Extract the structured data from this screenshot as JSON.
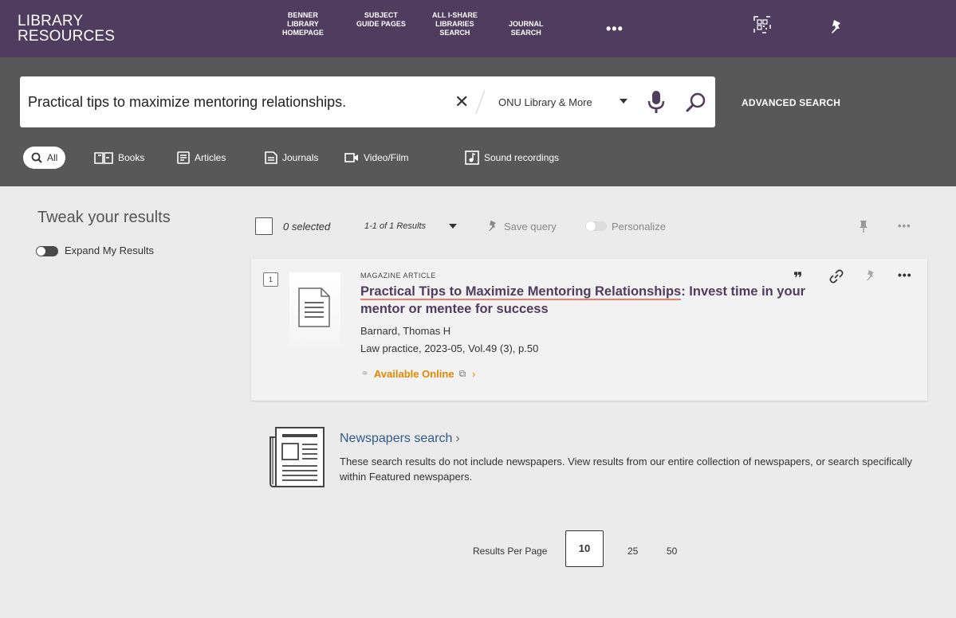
{
  "header": {
    "logo_line1": "LIBRARY",
    "logo_line2": "RESOURCES",
    "nav": [
      {
        "label": "BENNER\nLIBRARY\nHOMEPAGE"
      },
      {
        "label": "SUBJECT\nGUIDE PAGES"
      },
      {
        "label": "ALL I-SHARE\nLIBRARIES\nSEARCH"
      },
      {
        "label": "JOURNAL\nSEARCH"
      }
    ],
    "more_label": "•••",
    "icons": [
      "qr-code-icon",
      "pin-icon"
    ],
    "background": "#4f3c5e"
  },
  "search": {
    "query": "Practical tips to maximize mentoring relationships.",
    "clear_label": "✕",
    "scope": "ONU Library & More",
    "advanced_label": "ADVANCED SEARCH"
  },
  "tabs": [
    {
      "label": "All",
      "icon": "search-icon",
      "active": true
    },
    {
      "label": "Books",
      "icon": "book-icon"
    },
    {
      "label": "Articles",
      "icon": "article-icon"
    },
    {
      "label": "Journals",
      "icon": "journal-icon"
    },
    {
      "label": "Video/Film",
      "icon": "video-icon"
    },
    {
      "label": "Sound recordings",
      "icon": "sound-icon"
    }
  ],
  "facets": {
    "title": "Tweak your results",
    "expand_label": "Expand My Results"
  },
  "toolbar": {
    "selected": "0 selected",
    "range": "1-1 of 1 Results",
    "save_query": "Save query",
    "personalize": "Personalize",
    "more": "•••"
  },
  "result": {
    "number": "1",
    "type": "MAGAZINE ARTICLE",
    "title_main": "Practical Tips to Maximize Mentoring Relationships",
    "title_sub": ": Invest time in your mentor or mentee for success",
    "author": "Barnard, Thomas H",
    "source": "Law practice, 2023-05, Vol.49 (3), p.50",
    "availability": "Available Online",
    "cite": "❞",
    "more": "•••"
  },
  "newspapers": {
    "title": "Newspapers search",
    "chevron": "›",
    "description": "These search results do not include newspapers. View results from our entire collection of newspapers, or search specifically within Featured newspapers."
  },
  "pagination": {
    "label": "Results Per Page",
    "options": [
      "10",
      "25",
      "50"
    ],
    "selected": "10"
  },
  "colors": {
    "accent": "#4f3c5e",
    "available": "#e08800",
    "news_link": "#2f5c8a"
  }
}
